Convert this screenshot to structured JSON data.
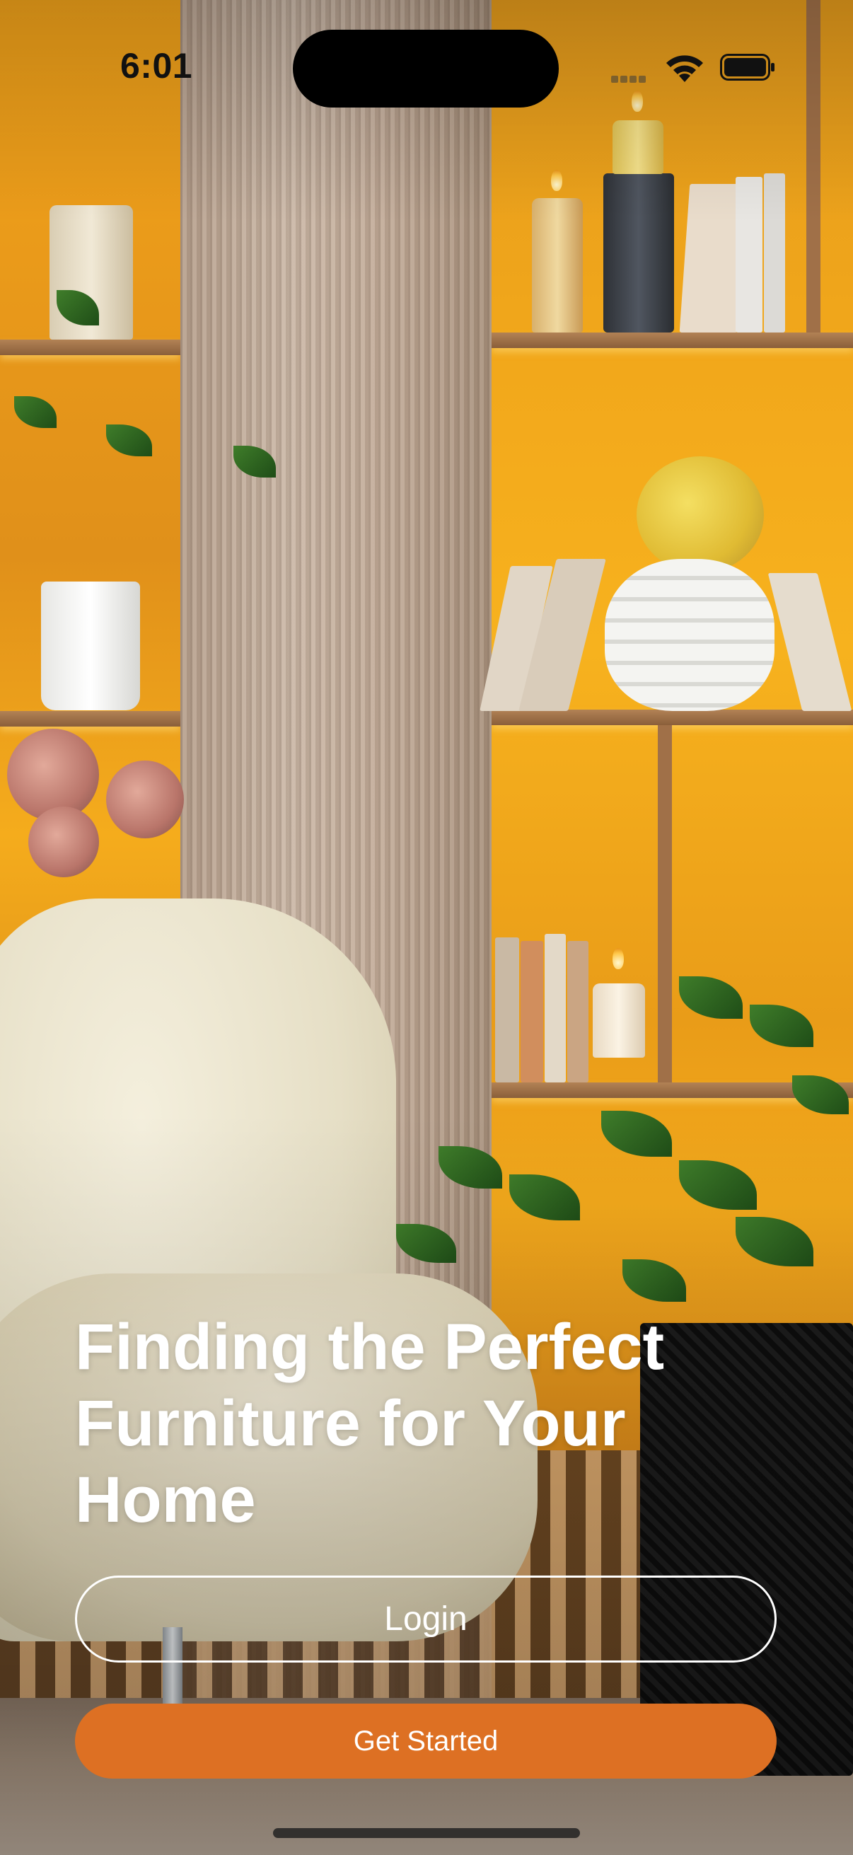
{
  "status_bar": {
    "time": "6:01",
    "icons": [
      "cellular-dots-icon",
      "wifi-icon",
      "battery-icon"
    ]
  },
  "hero": {
    "title_lines": [
      "Finding the Perfect",
      "Furniture for Your",
      "Home"
    ]
  },
  "actions": {
    "login_label": "Login",
    "get_started_label": "Get Started"
  },
  "colors": {
    "accent": "#dd7023",
    "text_on_image": "#ffffff",
    "login_border": "#ffffff"
  }
}
